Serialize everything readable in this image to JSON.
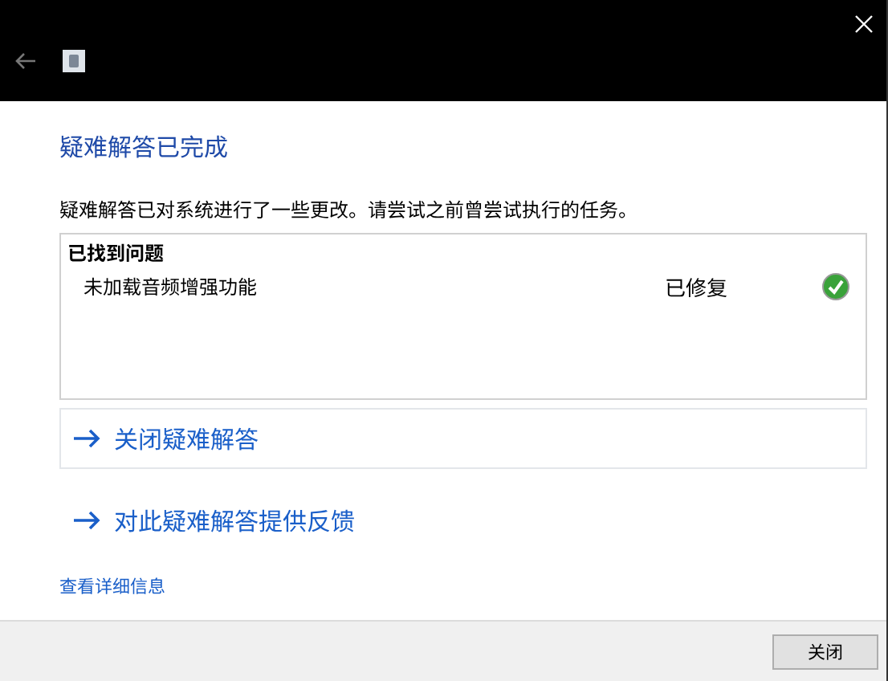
{
  "heading": "疑难解答已完成",
  "description": "疑难解答已对系统进行了一些更改。请尝试之前曾尝试执行的任务。",
  "problems": {
    "title": "已找到问题",
    "items": [
      {
        "name": "未加载音频增强功能",
        "status": "已修复",
        "fixed": true
      }
    ]
  },
  "links": [
    {
      "label": "关闭疑难解答",
      "focused": true
    },
    {
      "label": "对此疑难解答提供反馈",
      "focused": false
    }
  ],
  "details_link": "查看详细信息",
  "buttons": [
    "关闭"
  ]
}
